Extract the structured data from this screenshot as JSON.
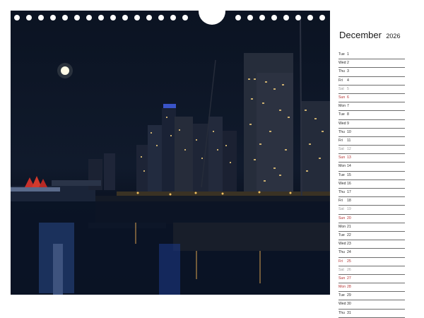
{
  "calendar": {
    "month": "December",
    "year": "2026",
    "days": [
      {
        "weekday": "Tue",
        "num": "1",
        "type": "weekday"
      },
      {
        "weekday": "Wed",
        "num": "2",
        "type": "weekday"
      },
      {
        "weekday": "Thu",
        "num": "3",
        "type": "weekday"
      },
      {
        "weekday": "Fri",
        "num": "4",
        "type": "weekday"
      },
      {
        "weekday": "Sat",
        "num": "5",
        "type": "sat"
      },
      {
        "weekday": "Sun",
        "num": "6",
        "type": "sun"
      },
      {
        "weekday": "Mon",
        "num": "7",
        "type": "weekday"
      },
      {
        "weekday": "Tue",
        "num": "8",
        "type": "weekday"
      },
      {
        "weekday": "Wed",
        "num": "9",
        "type": "weekday"
      },
      {
        "weekday": "Thu",
        "num": "10",
        "type": "weekday"
      },
      {
        "weekday": "Fri",
        "num": "11",
        "type": "weekday"
      },
      {
        "weekday": "Sat",
        "num": "12",
        "type": "sat"
      },
      {
        "weekday": "Sun",
        "num": "13",
        "type": "sun"
      },
      {
        "weekday": "Mon",
        "num": "14",
        "type": "weekday"
      },
      {
        "weekday": "Tue",
        "num": "15",
        "type": "weekday"
      },
      {
        "weekday": "Wed",
        "num": "16",
        "type": "weekday"
      },
      {
        "weekday": "Thu",
        "num": "17",
        "type": "weekday"
      },
      {
        "weekday": "Fri",
        "num": "18",
        "type": "weekday"
      },
      {
        "weekday": "Sat",
        "num": "19",
        "type": "sat"
      },
      {
        "weekday": "Sun",
        "num": "20",
        "type": "sun"
      },
      {
        "weekday": "Mon",
        "num": "21",
        "type": "weekday"
      },
      {
        "weekday": "Tue",
        "num": "22",
        "type": "weekday"
      },
      {
        "weekday": "Wed",
        "num": "23",
        "type": "weekday"
      },
      {
        "weekday": "Thu",
        "num": "24",
        "type": "weekday"
      },
      {
        "weekday": "Fri",
        "num": "25",
        "type": "sun"
      },
      {
        "weekday": "Sat",
        "num": "26",
        "type": "sat"
      },
      {
        "weekday": "Sun",
        "num": "27",
        "type": "sun"
      },
      {
        "weekday": "Mon",
        "num": "28",
        "type": "sun"
      },
      {
        "weekday": "Tue",
        "num": "29",
        "type": "weekday"
      },
      {
        "weekday": "Wed",
        "num": "30",
        "type": "weekday"
      },
      {
        "weekday": "Thu",
        "num": "31",
        "type": "weekday"
      }
    ]
  },
  "colors": {
    "sunday_holiday": "#b33030",
    "saturday": "#9a9a9a",
    "weekday": "#2a2a2a",
    "night_sky": "#0b1322"
  },
  "photo": {
    "subject": "night-harbor-skyline-with-full-moon"
  }
}
